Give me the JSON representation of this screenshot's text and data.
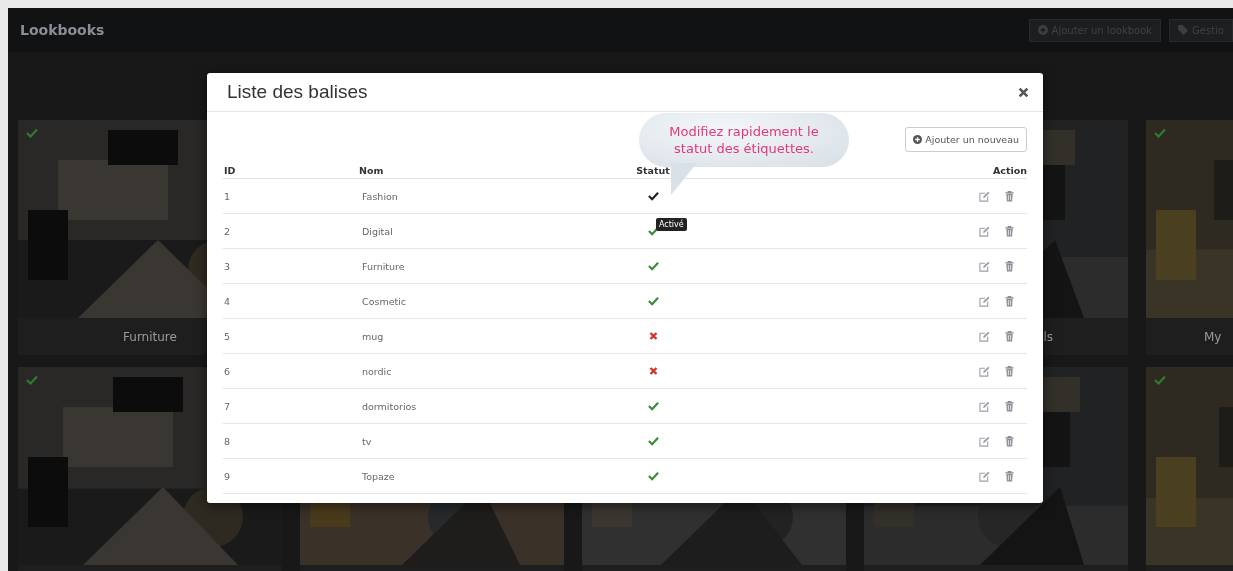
{
  "topbar": {
    "title": "Lookbooks",
    "buttons": [
      {
        "label": "Ajouter un lookbook"
      },
      {
        "label": "Gestio"
      }
    ]
  },
  "gallery": [
    {
      "label": "Furniture",
      "active": true
    },
    {
      "label": "ls"
    },
    {
      "label": "My",
      "active": true
    },
    {
      "active": true
    },
    {
      "active": true
    }
  ],
  "modal": {
    "title": "Liste des balises",
    "add_button": "Ajouter un nouveau",
    "callout": "Modifiez rapidement le statut des étiquettes.",
    "columns": [
      "ID",
      "Nom",
      "Statut",
      "Action"
    ],
    "rows": [
      {
        "id": "1",
        "name": "Fashion",
        "active": true,
        "highlighted": true
      },
      {
        "id": "2",
        "name": "Digital",
        "active": true,
        "highlighted": false,
        "tooltip": "Activé"
      },
      {
        "id": "3",
        "name": "Furniture",
        "active": true,
        "highlighted": false
      },
      {
        "id": "4",
        "name": "Cosmetic",
        "active": true,
        "highlighted": false
      },
      {
        "id": "5",
        "name": "mug",
        "active": false,
        "highlighted": false
      },
      {
        "id": "6",
        "name": "nordic",
        "active": false,
        "highlighted": false
      },
      {
        "id": "7",
        "name": "dormitorios",
        "active": true,
        "highlighted": false
      },
      {
        "id": "8",
        "name": "tv",
        "active": true,
        "highlighted": false
      },
      {
        "id": "9",
        "name": "Topaze",
        "active": true,
        "highlighted": false
      }
    ]
  }
}
